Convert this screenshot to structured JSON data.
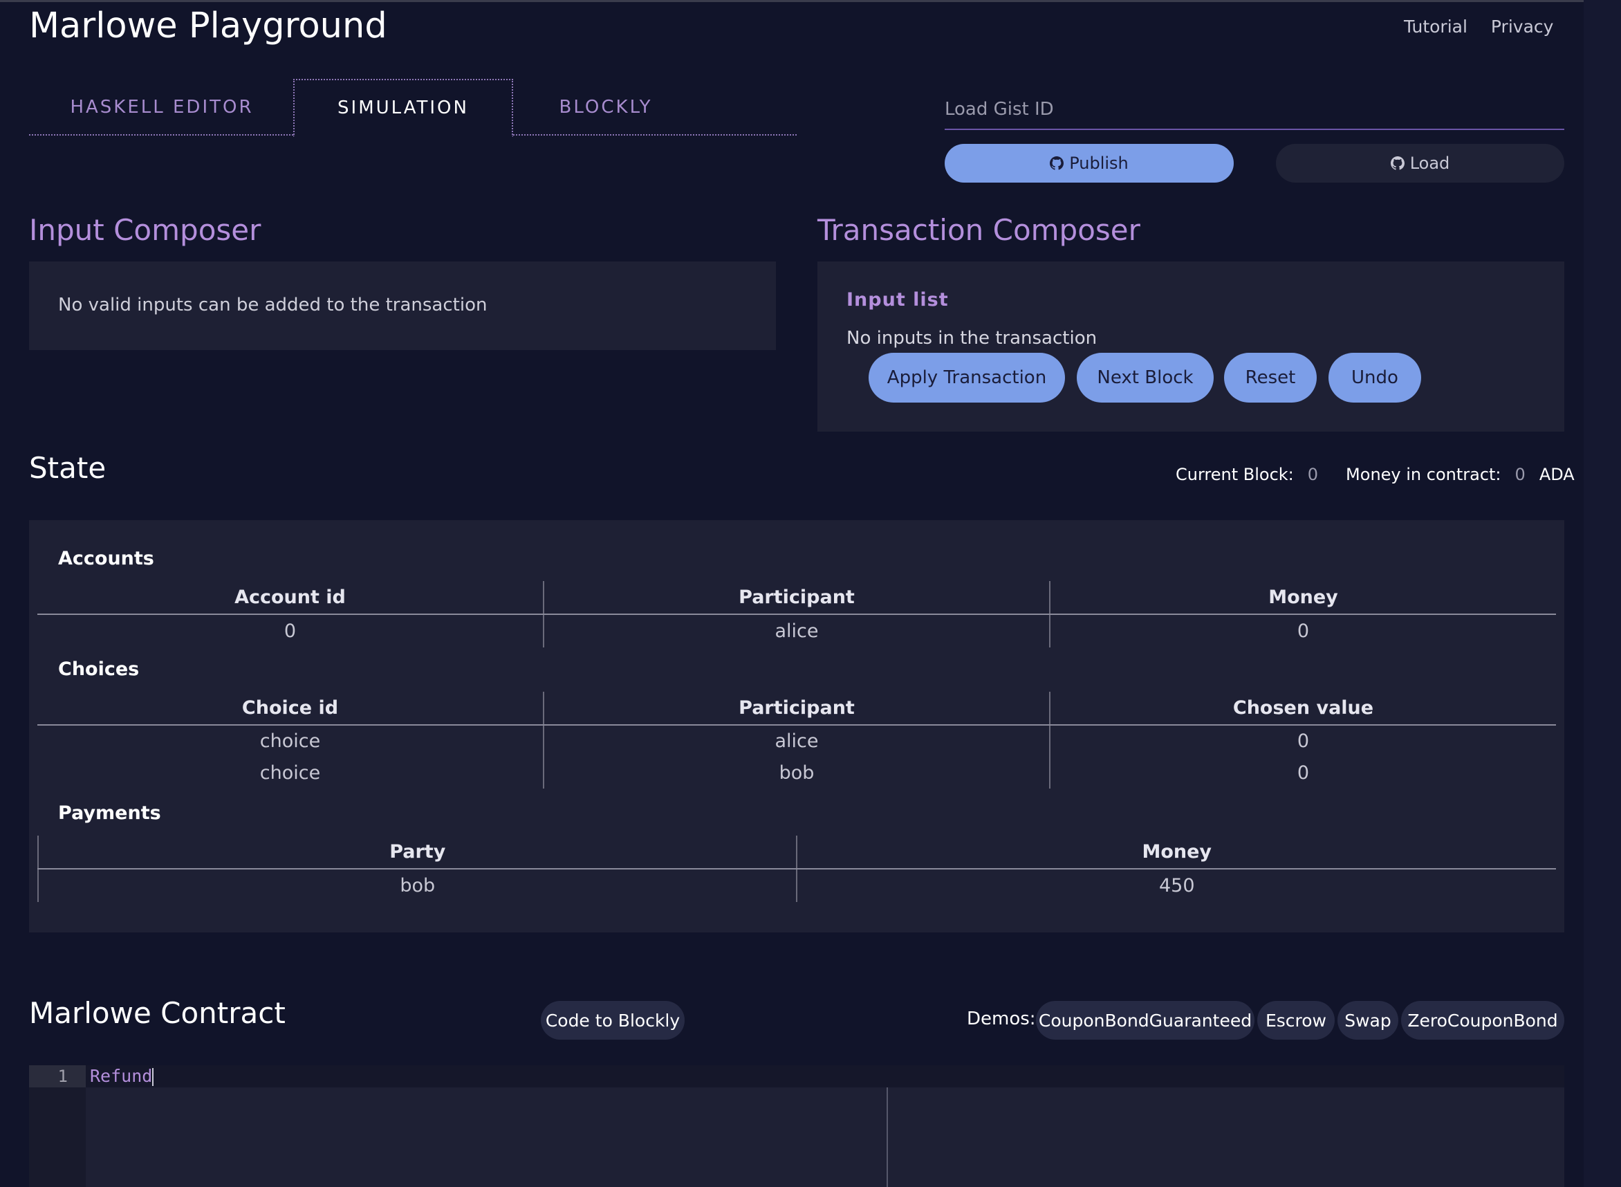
{
  "header": {
    "title": "Marlowe Playground",
    "links": [
      "Tutorial",
      "Privacy"
    ]
  },
  "tabs": [
    {
      "label": "HASKELL EDITOR",
      "active": false
    },
    {
      "label": "SIMULATION",
      "active": true
    },
    {
      "label": "BLOCKLY",
      "active": false
    }
  ],
  "gist": {
    "placeholder": "Load Gist ID",
    "publish_label": "Publish",
    "load_label": "Load"
  },
  "input_composer": {
    "title": "Input Composer",
    "message": "No valid inputs can be added to the transaction"
  },
  "transaction_composer": {
    "title": "Transaction Composer",
    "input_list_label": "Input list",
    "no_inputs": "No inputs in the transaction",
    "buttons": [
      "Apply Transaction",
      "Next Block",
      "Reset",
      "Undo"
    ]
  },
  "state": {
    "title": "State",
    "current_block_label": "Current Block:",
    "current_block": "0",
    "money_label": "Money in contract:",
    "money": "0",
    "currency": "ADA",
    "accounts": {
      "title": "Accounts",
      "headers": [
        "Account id",
        "Participant",
        "Money"
      ],
      "rows": [
        [
          "0",
          "alice",
          "0"
        ]
      ]
    },
    "choices": {
      "title": "Choices",
      "headers": [
        "Choice id",
        "Participant",
        "Chosen value"
      ],
      "rows": [
        [
          "choice",
          "alice",
          "0"
        ],
        [
          "choice",
          "bob",
          "0"
        ]
      ]
    },
    "payments": {
      "title": "Payments",
      "headers": [
        "Party",
        "Money"
      ],
      "rows": [
        [
          "bob",
          "450"
        ]
      ]
    }
  },
  "contract": {
    "title": "Marlowe Contract",
    "code_to_blockly_label": "Code to Blockly",
    "demos_label": "Demos:",
    "demos": [
      "CouponBondGuaranteed",
      "Escrow",
      "Swap",
      "ZeroCouponBond"
    ],
    "line_number": "1",
    "code": "Refund"
  },
  "colors": {
    "background": "#11142a",
    "panel": "#1e2034",
    "accent_purple": "#b48fdc",
    "button_blue": "#7c9ee8"
  },
  "icons": {
    "publish": "github-icon",
    "load": "github-icon"
  }
}
